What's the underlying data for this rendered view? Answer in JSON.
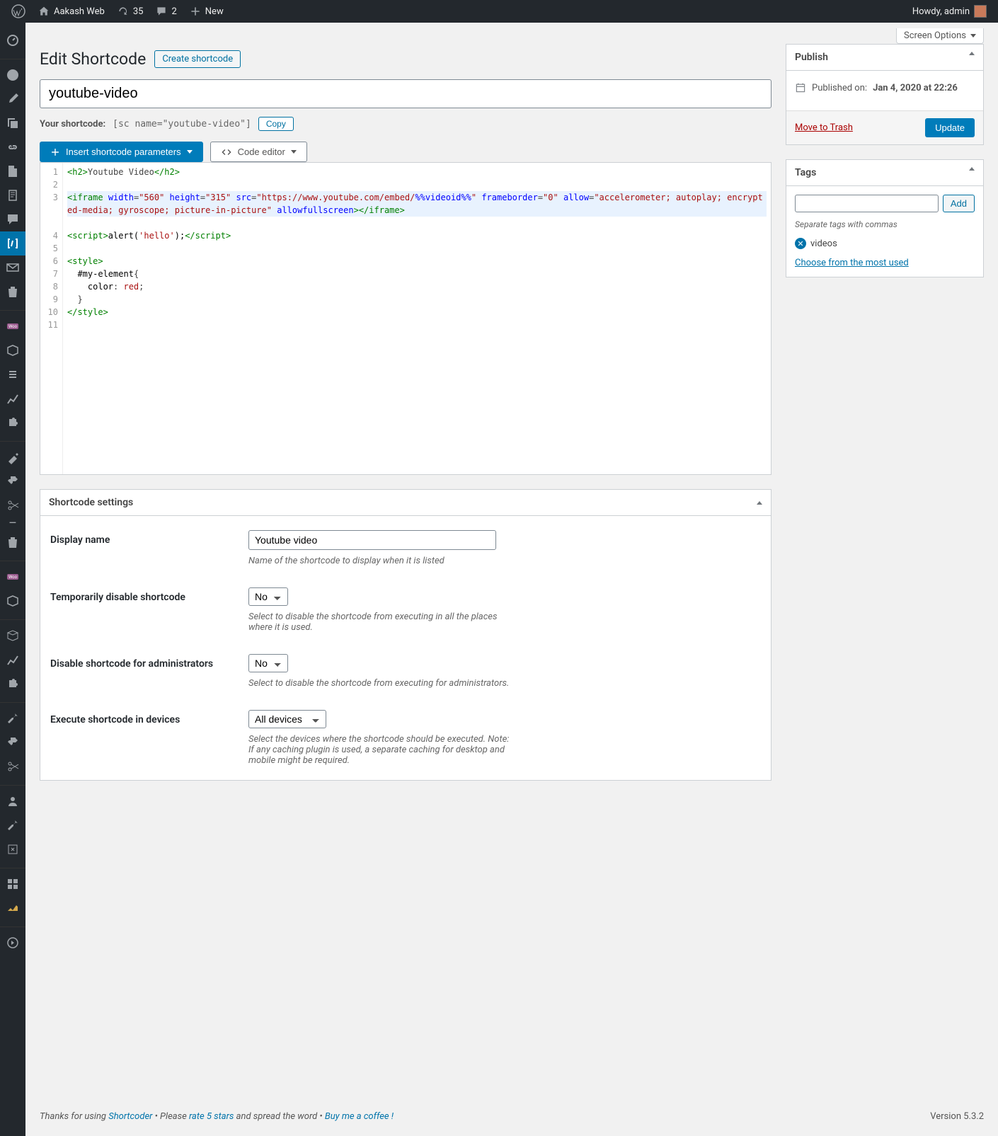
{
  "adminbar": {
    "site_name": "Aakash Web",
    "updates_count": "35",
    "comments_count": "2",
    "new_label": "New",
    "howdy": "Howdy, admin"
  },
  "screen_options": "Screen Options",
  "page_title": "Edit Shortcode",
  "create_btn": "Create shortcode",
  "title_value": "youtube-video",
  "shortcode_label": "Your shortcode:",
  "shortcode_code": "[sc name=\"youtube-video\"]",
  "copy_label": "Copy",
  "insert_params_label": "Insert shortcode parameters",
  "code_editor_label": "Code editor",
  "code_lines": [
    "1",
    "2",
    "3",
    "4",
    "5",
    "6",
    "7",
    "8",
    "9",
    "10",
    "11"
  ],
  "settings_panel_title": "Shortcode settings",
  "settings": {
    "display_name": {
      "label": "Display name",
      "value": "Youtube video",
      "help": "Name of the shortcode to display when it is listed"
    },
    "temp_disable": {
      "label": "Temporarily disable shortcode",
      "value": "No",
      "help": "Select to disable the shortcode from executing in all the places where it is used."
    },
    "disable_admin": {
      "label": "Disable shortcode for administrators",
      "value": "No",
      "help": "Select to disable the shortcode from executing for administrators."
    },
    "devices": {
      "label": "Execute shortcode in devices",
      "value": "All devices",
      "help": "Select the devices where the shortcode should be executed. Note: If any caching plugin is used, a separate caching for desktop and mobile might be required."
    }
  },
  "publish": {
    "title": "Publish",
    "published_label": "Published on:",
    "published_date": "Jan 4, 2020 at 22:26",
    "trash": "Move to Trash",
    "update": "Update"
  },
  "tags": {
    "title": "Tags",
    "add": "Add",
    "help": "Separate tags with commas",
    "chip": "videos",
    "choose": "Choose from the most used"
  },
  "footer": {
    "thanks": "Thanks for using ",
    "shortcoder": "Shortcoder",
    "please": " • Please ",
    "rate": "rate 5 stars",
    "spread": " and spread the word • ",
    "coffee": "Buy me a coffee !",
    "version": "Version 5.3.2"
  }
}
